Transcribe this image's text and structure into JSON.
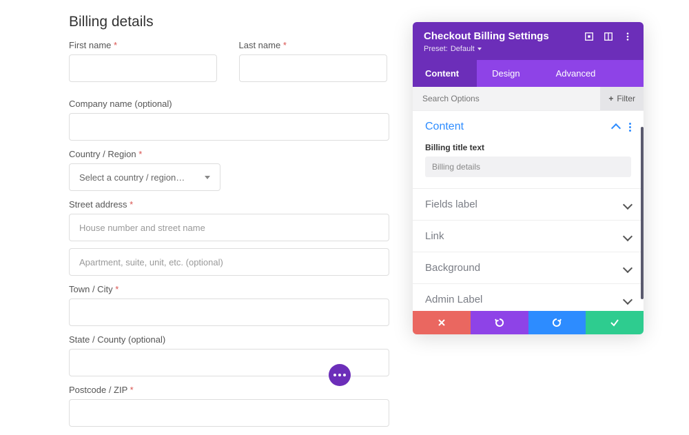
{
  "form": {
    "heading": "Billing details",
    "first_name_label": "First name",
    "last_name_label": "Last name",
    "company_label": "Company name (optional)",
    "country_label": "Country / Region",
    "country_placeholder": "Select a country / region…",
    "street_label": "Street address",
    "street_ph1": "House number and street name",
    "street_ph2": "Apartment, suite, unit, etc. (optional)",
    "town_label": "Town / City",
    "state_label": "State / County (optional)",
    "postcode_label": "Postcode / ZIP",
    "asterisk": "*"
  },
  "panel": {
    "title": "Checkout Billing Settings",
    "preset_prefix": "Preset: ",
    "preset_value": "Default",
    "tabs": {
      "content": "Content",
      "design": "Design",
      "advanced": "Advanced"
    },
    "search_placeholder": "Search Options",
    "filter_label": "Filter",
    "plus": "+",
    "sections": {
      "content": "Content",
      "billing_title_label": "Billing title text",
      "billing_title_value": "Billing details",
      "fields_label": "Fields label",
      "link": "Link",
      "background": "Background",
      "admin_label": "Admin Label"
    }
  }
}
